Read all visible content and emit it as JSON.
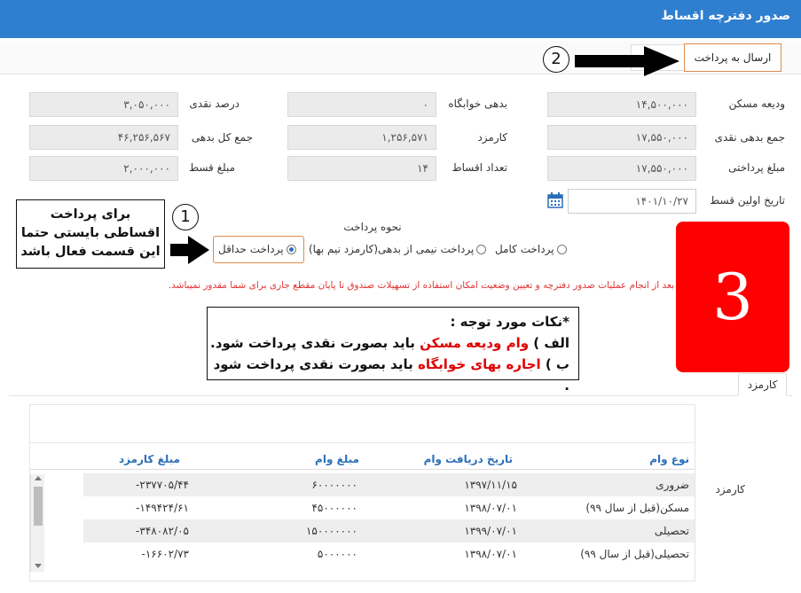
{
  "window": {
    "title": "صدور دفترچه اقساط"
  },
  "toolbar": {
    "send_label": "ارسال به پرداخت"
  },
  "annotations": {
    "step1": "1",
    "step2": "2",
    "step3": "3",
    "note_left": [
      "برای پرداخت",
      "اقساطی بایستی حتما",
      "این قسمت فعال باشد"
    ],
    "note_center": {
      "title": "*نکات مورد توجه :",
      "line1_a": "الف )",
      "line1_red": "وام ودیعه مسکن",
      "line1_b": "باید بصورت نقدی پرداخت شود.",
      "line2_a": "ب )",
      "line2_red": "اجاره بهای خوابگاه",
      "line2_b": "باید بصورت نقدی پرداخت شود ."
    }
  },
  "form": {
    "deposit_label": "ودیعه مسکن",
    "deposit_value": "۱۴,۵۰۰,۰۰۰",
    "dorm_debt_label": "بدهی خوابگاه",
    "dorm_debt_value": "۰",
    "cash_percent_label": "درصد نقدی",
    "cash_percent_value": "۳,۰۵۰,۰۰۰",
    "cash_debt_sum_label": "جمع بدهی نقدی",
    "cash_debt_sum_value": "۱۷,۵۵۰,۰۰۰",
    "fee_label": "کارمزد",
    "fee_value": "۱,۲۵۶,۵۷۱",
    "total_debt_label": "جمع کل بدهی",
    "total_debt_value": "۴۶,۲۵۶,۵۶۷",
    "payment_amount_label": "مبلغ پرداختی",
    "payment_amount_value": "۱۷,۵۵۰,۰۰۰",
    "installments_label": "تعداد اقساط",
    "installments_value": "۱۴",
    "installment_amount_label": "مبلغ قسط",
    "installment_amount_value": "۲,۰۰۰,۰۰۰",
    "first_installment_label": "تاریخ اولین قسط",
    "first_installment_value": "۱۴۰۱/۱۰/۲۷"
  },
  "payment": {
    "heading": "نحوه پرداخت",
    "full": "پرداخت کامل",
    "half": "پرداخت نیمی از بدهی(کارمزد نیم بها)",
    "minimum": "پرداخت حداقل",
    "selected": "minimum"
  },
  "warning": "بعد از انجام عملیات صدور دفترچه و تعیین وضعیت امکان استفاده از تسهیلات صندوق تا پایان مقطع جاری برای شما مقدور نمیباشد.",
  "tabs": {
    "fee_tab": "کارمزد"
  },
  "fee_table": {
    "side_label": "کارمزد",
    "headers": {
      "loan_type": "نوع وام",
      "receive_date": "تاریخ دریافت وام",
      "loan_amount": "مبلغ وام",
      "fee_amount": "مبلغ کارمزد"
    },
    "rows": [
      {
        "loan_type": "ضروری",
        "receive_date": "۱۳۹۷/۱۱/۱۵",
        "loan_amount": "۶۰۰۰۰۰۰۰",
        "fee_amount": "۲۳۷۷۰۵/۴۴-"
      },
      {
        "loan_type": "مسکن(قبل از سال ۹۹)",
        "receive_date": "۱۳۹۸/۰۷/۰۱",
        "loan_amount": "۴۵۰۰۰۰۰۰",
        "fee_amount": "۱۴۹۴۲۴/۶۱-"
      },
      {
        "loan_type": "تحصیلی",
        "receive_date": "۱۳۹۹/۰۷/۰۱",
        "loan_amount": "۱۵۰۰۰۰۰۰۰",
        "fee_amount": "۳۴۸۰۸۲/۰۵-"
      },
      {
        "loan_type": "تحصیلی(قبل از سال ۹۹)",
        "receive_date": "۱۳۹۸/۰۷/۰۱",
        "loan_amount": "۵۰۰۰۰۰۰",
        "fee_amount": "۱۶۶۰۲/۷۳-"
      }
    ]
  },
  "colors": {
    "header_blue": "#2f7fd0",
    "accent_orange": "#e08a4a",
    "warning_red": "#e03434",
    "badge_red": "#ff0000"
  }
}
